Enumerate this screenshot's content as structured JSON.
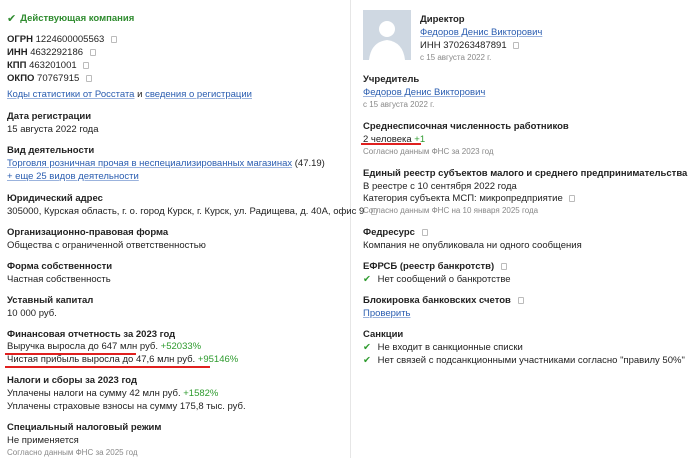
{
  "left": {
    "status": "Действующая компания",
    "ogrn_label": "ОГРН",
    "ogrn": "1224600005563",
    "inn_label": "ИНН",
    "inn": "4632292186",
    "kpp_label": "КПП",
    "kpp": "463201001",
    "okpo_label": "ОКПО",
    "okpo": "70767915",
    "codes_link1": "Коды статистики от Росстата",
    "codes_and": "и",
    "codes_link2": "сведения о регистрации",
    "reg_date_title": "Дата регистрации",
    "reg_date": "15 августа 2022 года",
    "activity_title": "Вид деятельности",
    "activity_link": "Торговля розничная прочая в неспециализированных магазинах",
    "activity_code": "(47.19)",
    "activity_more": "+ еще 25 видов деятельности",
    "address_title": "Юридический адрес",
    "address": "305000, Курская область, г. о. город Курск, г. Курск, ул. Радищева, д. 40А, офис 9",
    "legal_form_title": "Организационно-правовая форма",
    "legal_form": "Общества с ограниченной ответственностью",
    "ownership_title": "Форма собственности",
    "ownership": "Частная собственность",
    "capital_title": "Уставный капитал",
    "capital": "10 000 руб.",
    "finance_title": "Финансовая отчетность за 2023 год",
    "revenue_text": "Выручка выросла до 647 млн руб.",
    "revenue_delta": "+52033%",
    "profit_text": "Чистая прибыль выросла до 47,6 млн руб.",
    "profit_delta": "+95146%",
    "taxes_title": "Налоги и сборы за 2023 год",
    "taxes_text": "Уплачены налоги на сумму 42 млн руб.",
    "taxes_delta": "+1582%",
    "insurance_text": "Уплачены страховые взносы на сумму 175,8 тыс. руб.",
    "tax_regime_title": "Специальный налоговый режим",
    "tax_regime": "Не применяется",
    "tax_regime_note": "Согласно данным ФНС за 2025 год"
  },
  "right": {
    "director_title": "Директор",
    "director_name": "Федоров Денис Викторович",
    "director_inn_label": "ИНН",
    "director_inn": "370263487891",
    "director_since": "с 15 августа 2022 г.",
    "founder_title": "Учредитель",
    "founder_name": "Федоров Денис Викторович",
    "founder_since": "с 15 августа 2022 г.",
    "headcount_title": "Среднесписочная численность работников",
    "headcount": "2 человека",
    "headcount_delta": "+1",
    "headcount_note": "Согласно данным ФНС за 2023 год",
    "smb_title": "Единый реестр субъектов малого и среднего предпринимательства",
    "smb_date": "В реестре с 10 сентября 2022 года",
    "smb_category": "Категория субъекта МСП: микропредприятие",
    "smb_note": "Согласно данным ФНС на 10 января 2025 года",
    "fedresurs_title": "Федресурс",
    "fedresurs": "Компания не опубликовала ни одного сообщения",
    "efrsb_title": "ЕФРСБ (реестр банкротств)",
    "efrsb": "Нет сообщений о банкротстве",
    "bank_block_title": "Блокировка банковских счетов",
    "bank_block_link": "Проверить",
    "sanctions_title": "Санкции",
    "sanctions_1": "Не входит в санкционные списки",
    "sanctions_2": "Нет связей с подсанкционными участниками согласно \"правилу 50%\""
  },
  "colors": {
    "accent_link": "#2a5db0",
    "positive": "#2e9b2e",
    "highlight": "#e0201f"
  }
}
